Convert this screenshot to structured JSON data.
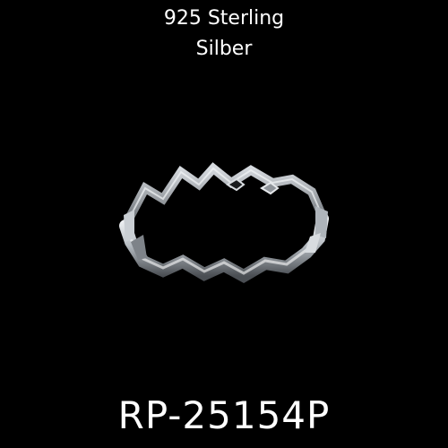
{
  "caption": {
    "line1": "925 Sterling",
    "line2": "Silber"
  },
  "product": {
    "code": "RP-25154P"
  },
  "image": {
    "subject": "ring-photo",
    "colors": {
      "background": "#000000",
      "text": "#ffffff",
      "metal_light": "#e9ecef",
      "metal_mid": "#9aa0a6",
      "metal_dark": "#3a3d41"
    }
  }
}
